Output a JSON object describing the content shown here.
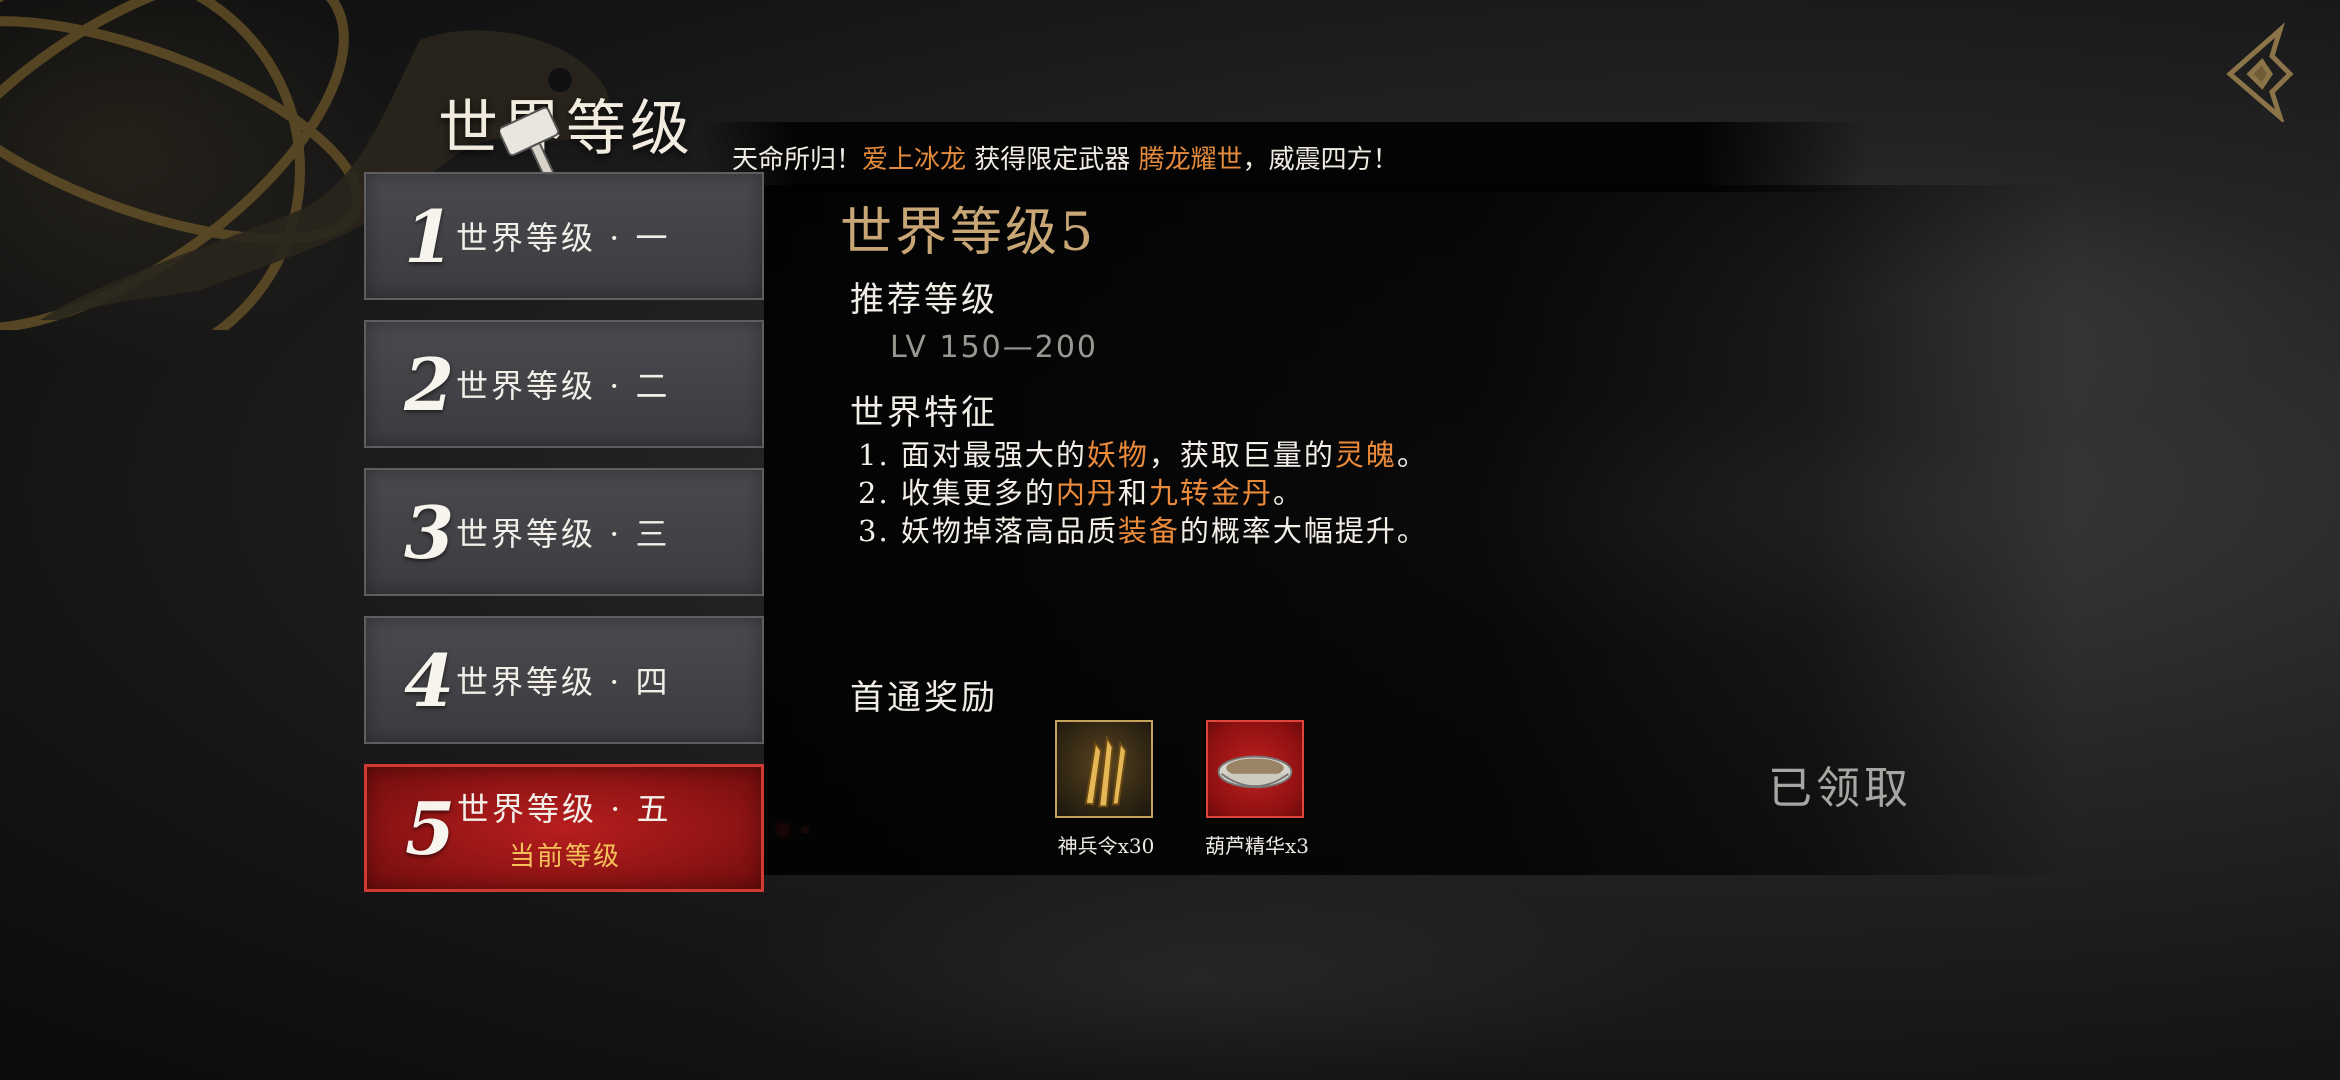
{
  "page": {
    "title": "世界等级"
  },
  "announcement": {
    "prefix": "天命所归！",
    "player": "爱上冰龙",
    "middle": " 获得限定武器 ",
    "weapon": "腾龙耀世",
    "suffix": "，威震四方！"
  },
  "levels": [
    {
      "num": "1",
      "label": "世界等级 · 一"
    },
    {
      "num": "2",
      "label": "世界等级 · 二"
    },
    {
      "num": "3",
      "label": "世界等级 · 三"
    },
    {
      "num": "4",
      "label": "世界等级 · 四"
    },
    {
      "num": "5",
      "label": "世界等级 · 五",
      "sub": "当前等级"
    }
  ],
  "detail": {
    "title": "世界等级5",
    "recommend_title": "推荐等级",
    "recommend_value": "LV 150—200",
    "feature_title": "世界特征",
    "features": [
      {
        "a": "1. 面对最强大的",
        "h1": "妖物",
        "b": "，获取巨量的",
        "h2": "灵魄",
        "c": "。"
      },
      {
        "a": "2. 收集更多的",
        "h1": "内丹",
        "b": "和",
        "h2": "九转金丹",
        "c": "。"
      },
      {
        "a": "3. 妖物掉落高品质",
        "h1": "装备",
        "b": "的概率大幅提升。",
        "h2": "",
        "c": ""
      }
    ],
    "reward_title": "首通奖励",
    "rewards": [
      {
        "name": "神兵令x30",
        "icon": "arrow-token-icon"
      },
      {
        "name": "葫芦精华x3",
        "icon": "essence-bowl-icon"
      }
    ],
    "claimed": "已领取"
  },
  "colors": {
    "accent_orange": "#ea8a3a",
    "gold_title": "#c9a675",
    "active_red": "#a81818",
    "sub_gold": "#f5c15a"
  }
}
